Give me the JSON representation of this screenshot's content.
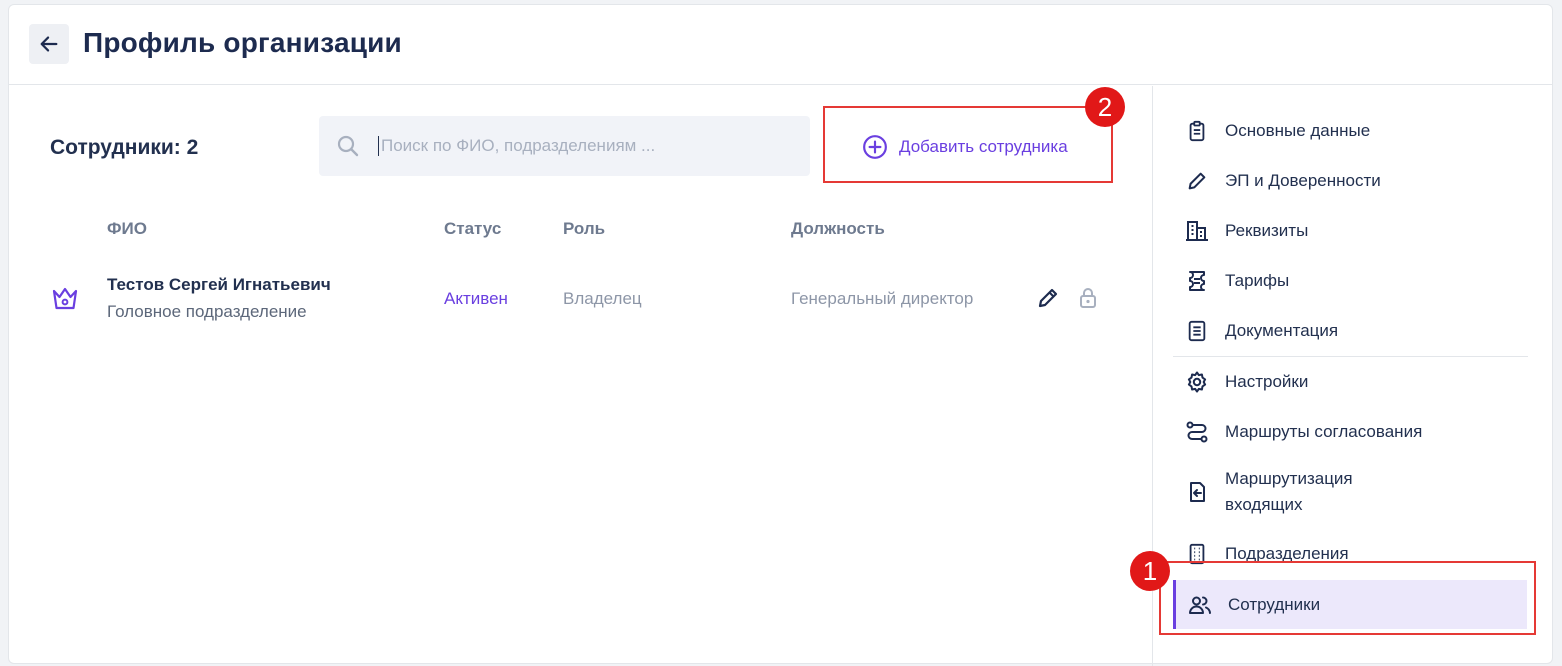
{
  "header": {
    "title": "Профиль организации"
  },
  "main": {
    "employees_count_label": "Сотрудники: 2",
    "search": {
      "placeholder": "Поиск по ФИО, подразделениям ...",
      "value": ""
    },
    "add_button_label": "Добавить сотрудника",
    "table": {
      "columns": [
        "ФИО",
        "Статус",
        "Роль",
        "Должность"
      ],
      "rows": [
        {
          "name": "Тестов Сергей Игнатьевич",
          "department": "Головное подразделение",
          "status": "Активен",
          "role": "Владелец",
          "position": "Генеральный директор"
        }
      ]
    }
  },
  "sidebar": {
    "items": [
      {
        "label": "Основные данные",
        "icon": "clipboard-icon"
      },
      {
        "label": "ЭП и Доверенности",
        "icon": "pencil-icon"
      },
      {
        "label": "Реквизиты",
        "icon": "buildings-icon"
      },
      {
        "label": "Тарифы",
        "icon": "tariff-icon"
      },
      {
        "label": "Документация",
        "icon": "document-icon"
      },
      {
        "label": "Настройки",
        "icon": "gear-icon"
      },
      {
        "label": "Маршруты согласования",
        "icon": "route-icon"
      },
      {
        "label": "Маршрутизация\nвходящих",
        "icon": "incoming-routing-icon"
      },
      {
        "label": "Подразделения",
        "icon": "office-building-icon"
      },
      {
        "label": "Сотрудники",
        "icon": "users-icon",
        "active": true
      }
    ]
  },
  "annotations": {
    "marker_1": "1",
    "marker_2": "2"
  },
  "colors": {
    "accent": "#6a3fe0",
    "title": "#1d2b4f",
    "highlight": "#e53935",
    "active_bg": "#ece8fb"
  }
}
